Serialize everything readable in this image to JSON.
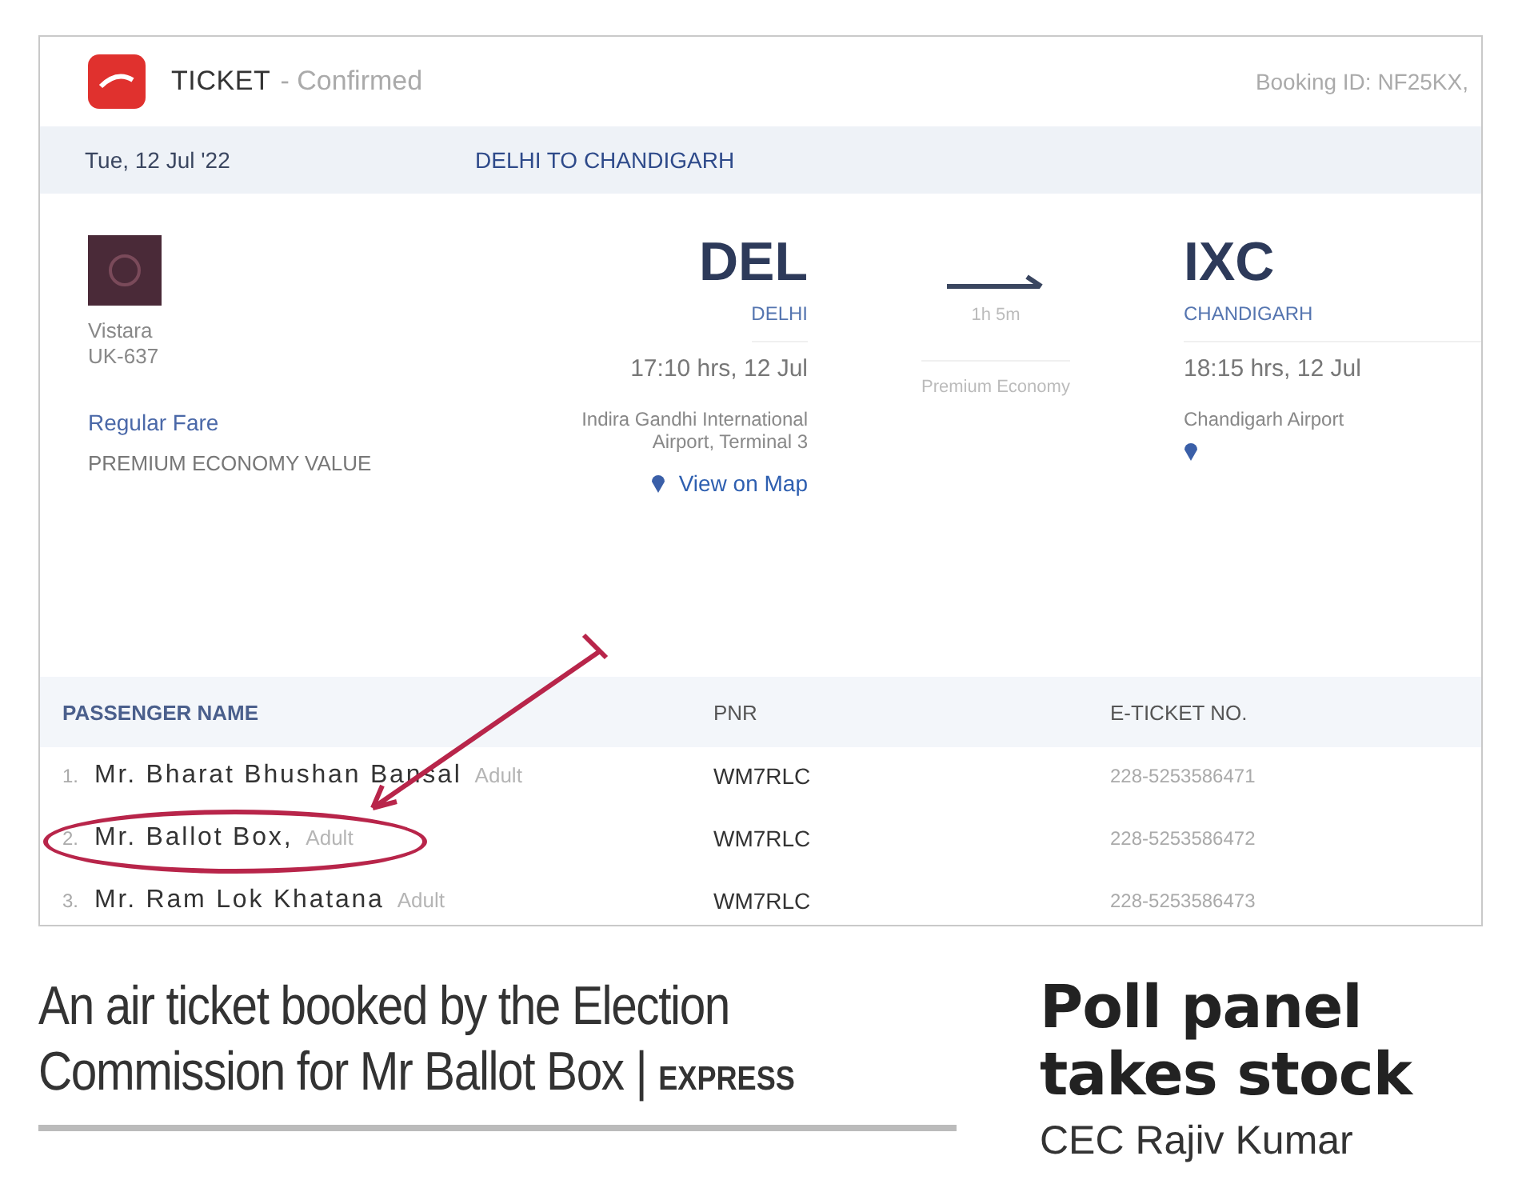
{
  "ticket": {
    "title": "TICKET",
    "status": "- Confirmed",
    "booking_id": "Booking ID: NF25KX,",
    "date": "Tue, 12 Jul '22",
    "route": "DELHI TO CHANDIGARH",
    "airline": "Vistara",
    "flight": "UK-637",
    "fare_type": "Regular Fare",
    "fare_class": "PREMIUM ECONOMY VALUE",
    "departure": {
      "code": "DEL",
      "city": "DELHI",
      "time": "17:10 hrs, 12 Jul",
      "airport": "Indira Gandhi International Airport, Terminal 3"
    },
    "duration": "1h 5m",
    "cabin": "Premium Economy",
    "arrival": {
      "code": "IXC",
      "city": "CHANDIGARH",
      "time": "18:15 hrs, 12 Jul",
      "airport": "Chandigarh Airport"
    },
    "map_link": "View on Map",
    "columns": [
      "PASSENGER NAME",
      "PNR",
      "E-TICKET NO."
    ],
    "passengers": [
      {
        "index": "1.",
        "name": "Mr. Bharat Bhushan Bansal",
        "type": "Adult",
        "pnr": "WM7RLC",
        "eticket": "228-5253586471",
        "circled": false
      },
      {
        "index": "2.",
        "name": "Mr. Ballot Box,",
        "type": "Adult",
        "pnr": "WM7RLC",
        "eticket": "228-5253586472",
        "circled": true
      },
      {
        "index": "3.",
        "name": "Mr. Ram Lok Khatana",
        "type": "Adult",
        "pnr": "WM7RLC",
        "eticket": "228-5253586473",
        "circled": false
      }
    ]
  },
  "caption": {
    "text": "An air ticket booked by the Election Commission for Mr Ballot Box |",
    "credit": "EXPRESS"
  },
  "article": {
    "headline": "Poll panel takes stock",
    "body": "CEC Rajiv Kumar"
  }
}
